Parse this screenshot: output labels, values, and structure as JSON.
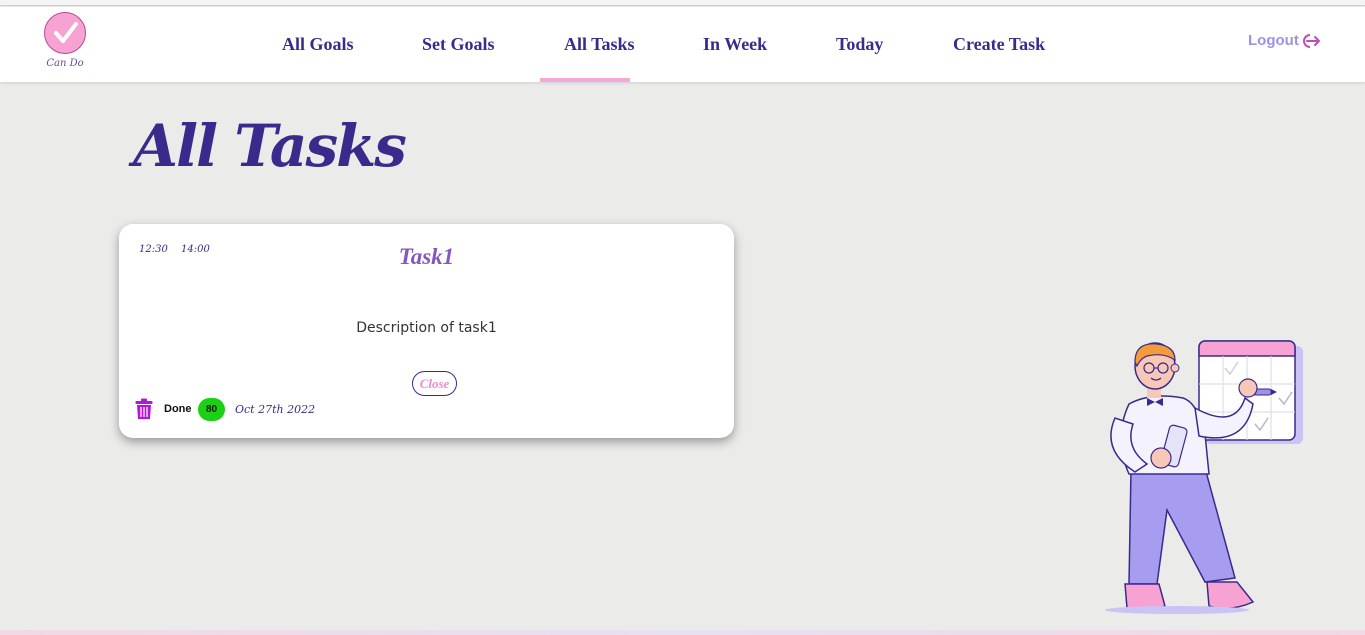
{
  "app": {
    "brand_name": "Can Do",
    "accent_color": "#3b2a8c",
    "logo_color": "#f6a3d3"
  },
  "nav": {
    "items": [
      {
        "label": "All Goals",
        "active": false
      },
      {
        "label": "Set Goals",
        "active": false
      },
      {
        "label": "All Tasks",
        "active": true
      },
      {
        "label": "In Week",
        "active": false
      },
      {
        "label": "Today",
        "active": false
      },
      {
        "label": "Create Task",
        "active": false
      }
    ],
    "logout_label": "Logout",
    "logout_icon": "logout-arrow-icon"
  },
  "page": {
    "title": "All Tasks"
  },
  "tasks": [
    {
      "start_time": "12:30",
      "end_time": "14:00",
      "title": "Task1",
      "description": "Description of task1",
      "close_label": "Close",
      "delete_icon": "trash-icon",
      "status_label": "Done",
      "score": "80",
      "score_color": "#1bd015",
      "date": "Oct 27th 2022"
    }
  ],
  "illustration": {
    "icon": "person-with-calendar-illustration"
  }
}
